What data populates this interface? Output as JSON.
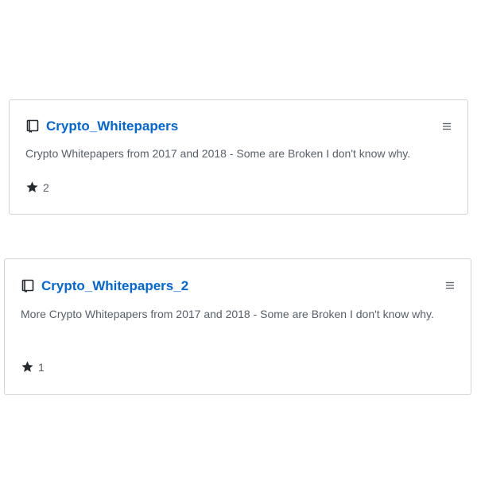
{
  "repos": [
    {
      "name": "Crypto_Whitepapers",
      "description": "Crypto Whitepapers from 2017 and 2018 - Some are Broken I don't know why.",
      "stars": "2"
    },
    {
      "name": "Crypto_Whitepapers_2",
      "description": "More Crypto Whitepapers from 2017 and 2018 - Some are Broken I don't know why.",
      "stars": "1"
    }
  ],
  "icons": {
    "repo": "repo-book-icon",
    "menu": "hamburger-menu-icon",
    "star": "star-icon"
  },
  "colors": {
    "link": "#0366d6",
    "text": "#586069",
    "border": "#d1d5da"
  }
}
